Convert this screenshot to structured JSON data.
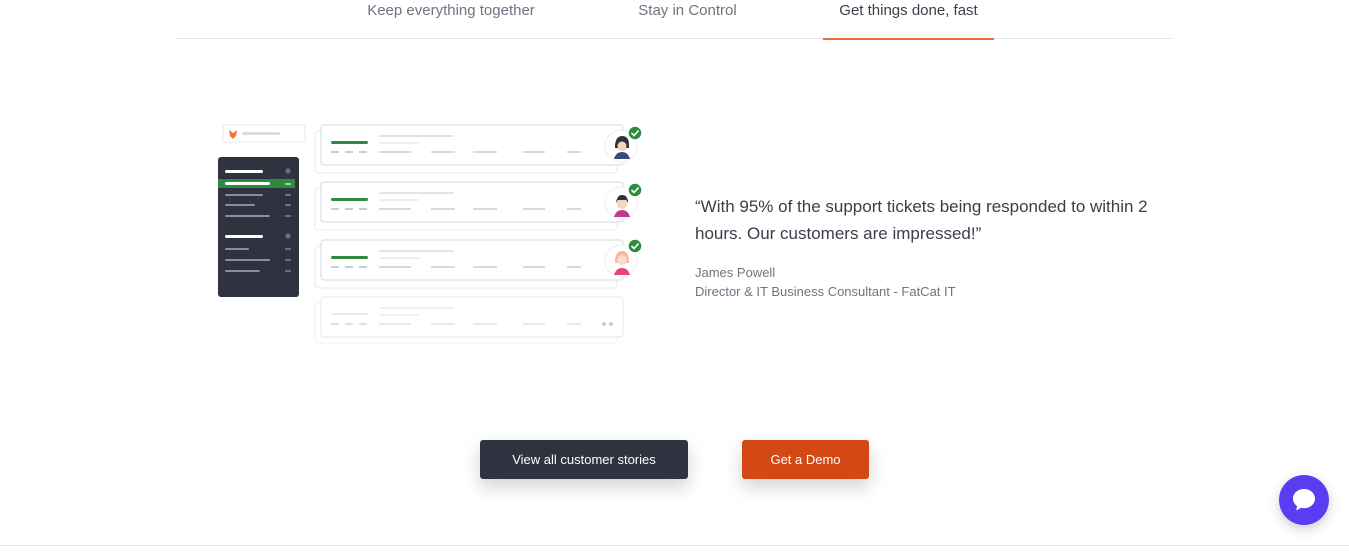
{
  "tabs": [
    {
      "label": "Keep everything together"
    },
    {
      "label": "Stay in Control"
    },
    {
      "label": "Get things done, fast"
    }
  ],
  "active_tab": "Get things done, fast",
  "testimonial": {
    "quote": "“With 95% of the support tickets being responded to within 2 hours. Our customers are impressed!”",
    "author_name": "James Powell",
    "author_title": "Director & IT Business Consultant - FatCat IT"
  },
  "buttons": {
    "stories_label": "View all customer stories",
    "demo_label": "Get a Demo"
  },
  "colors": {
    "accent_orange": "#d34815",
    "tab_underline": "#ef6c3a",
    "dark_button": "#2f3340",
    "success_green": "#2e8b3e",
    "chat_purple": "#5a3df0"
  },
  "icons": {
    "chat": "chat-bubble-icon",
    "check": "check-circle-icon",
    "logo": "fox-logo-icon"
  }
}
